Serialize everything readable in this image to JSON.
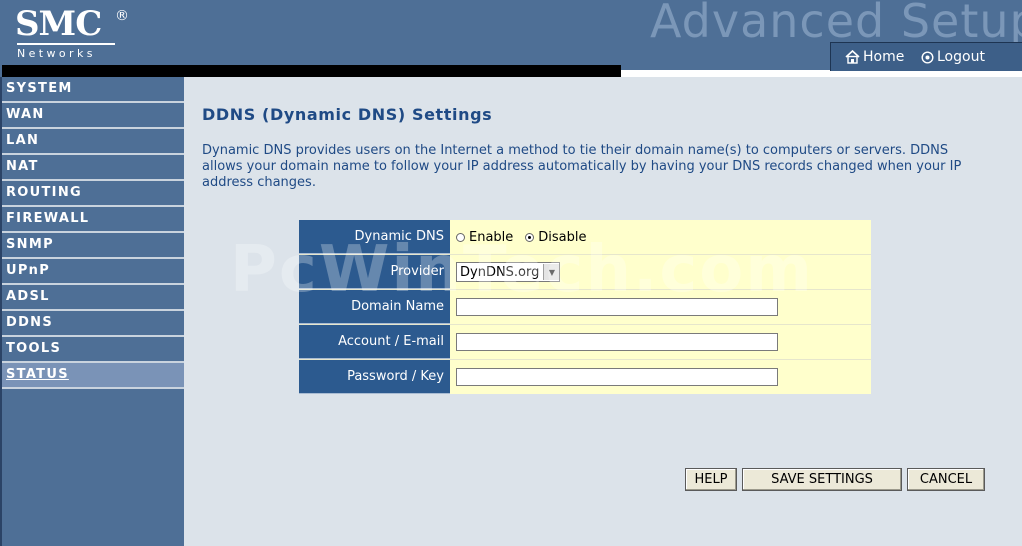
{
  "header": {
    "logo_brand": "SMC",
    "logo_reg": "®",
    "logo_sub": "Networks",
    "title": "Advanced Setup",
    "home_label": "Home",
    "logout_label": "Logout"
  },
  "sidebar": {
    "items": [
      {
        "label": "SYSTEM"
      },
      {
        "label": "WAN"
      },
      {
        "label": "LAN"
      },
      {
        "label": "NAT"
      },
      {
        "label": "ROUTING"
      },
      {
        "label": "FIREWALL"
      },
      {
        "label": "SNMP"
      },
      {
        "label": "UPnP"
      },
      {
        "label": "ADSL"
      },
      {
        "label": "DDNS"
      },
      {
        "label": "TOOLS"
      },
      {
        "label": "STATUS",
        "active": true
      }
    ]
  },
  "main": {
    "title": "DDNS (Dynamic DNS) Settings",
    "description": "Dynamic DNS provides users on the Internet a method to tie their domain name(s) to computers or servers. DDNS allows your domain name to follow your IP address automatically by having your DNS records changed when your IP address changes."
  },
  "form": {
    "dynamic_dns_label": "Dynamic DNS",
    "enable_label": "Enable",
    "disable_label": "Disable",
    "selected": "Disable",
    "provider_label": "Provider",
    "provider_value": "DynDNS.org",
    "domain_label": "Domain Name",
    "domain_value": "",
    "account_label": "Account / E-mail",
    "account_value": "",
    "password_label": "Password / Key",
    "password_value": ""
  },
  "buttons": {
    "help": "HELP",
    "save": "SAVE SETTINGS",
    "cancel": "CANCEL"
  },
  "watermark": "PcWinTech.com",
  "colors": {
    "header_bg": "#4e6f96",
    "label_bg": "#2c5a8f",
    "value_bg": "#ffffcc",
    "title_text": "#1f4a85",
    "page_bg": "#dce3ea"
  }
}
